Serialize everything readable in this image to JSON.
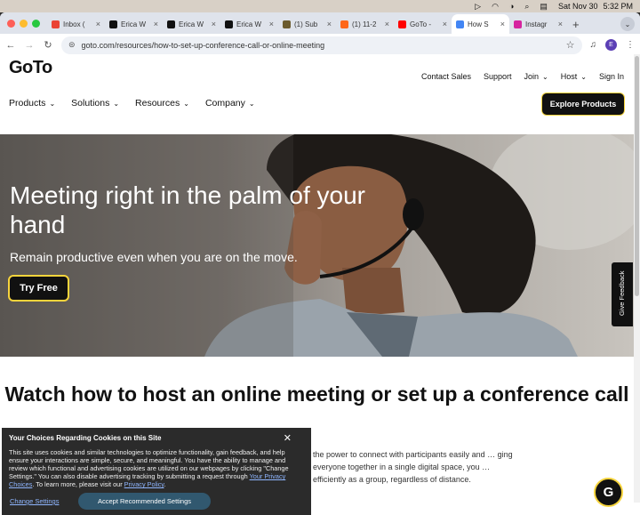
{
  "menubar": {
    "date": "Sat Nov 30",
    "time": "5:32 PM"
  },
  "tabs": [
    {
      "title": "Inbox (",
      "favicon": "gmail",
      "color": "#ea4335"
    },
    {
      "title": "Erica W",
      "favicon": "x",
      "color": "#111111"
    },
    {
      "title": "Erica W",
      "favicon": "x",
      "color": "#111111"
    },
    {
      "title": "Erica W",
      "favicon": "x",
      "color": "#111111"
    },
    {
      "title": "(1) Sub",
      "favicon": "substack",
      "color": "#6b5b2e"
    },
    {
      "title": "(1) 11-2",
      "favicon": "substack-orange",
      "color": "#ff6719"
    },
    {
      "title": "GoTo -",
      "favicon": "youtube",
      "color": "#ff0000"
    },
    {
      "title": "How S",
      "favicon": "google",
      "color": "#4285f4"
    },
    {
      "title": "Instagr",
      "favicon": "instagram",
      "color": "#d6249f"
    }
  ],
  "toolbar": {
    "url": "goto.com/resources/how-to-set-up-conference-call-or-online-meeting",
    "avatar_letter": "E"
  },
  "site": {
    "logo": "GoTo",
    "topnav": [
      "Contact Sales",
      "Support",
      "Join",
      "Host",
      "Sign In"
    ],
    "mainnav": [
      "Products",
      "Solutions",
      "Resources",
      "Company"
    ],
    "explore_button": "Explore Products"
  },
  "hero": {
    "title": "Meeting right in the palm of your hand",
    "subtitle": "Remain productive even when you are on the move.",
    "cta": "Try Free",
    "feedback": "Give Feedback"
  },
  "section": {
    "title": "Watch how to host an online meeting or set up a conference call",
    "body": "the power to connect with participants easily and … ging everyone together in a single digital space, you … efficiently as a group, regardless of distance."
  },
  "cookie": {
    "title": "Your Choices Regarding Cookies on this Site",
    "text_a": "This site uses cookies and similar technologies to optimize functionality, gain feedback, and help ensure your interactions are simple, secure, and meaningful. You have the ability to manage and review which functional and advertising cookies are utilized on our webpages by clicking \"Change Settings.\" You can also disable advertising tracking by submitting a request through ",
    "link_a": "Your Privacy Choices",
    "text_b": ". To learn more, please visit our ",
    "link_b": "Privacy Policy",
    "text_c": ".",
    "change_settings": "Change Settings",
    "accept": "Accept Recommended Settings"
  },
  "chat": {
    "letter": "G"
  }
}
